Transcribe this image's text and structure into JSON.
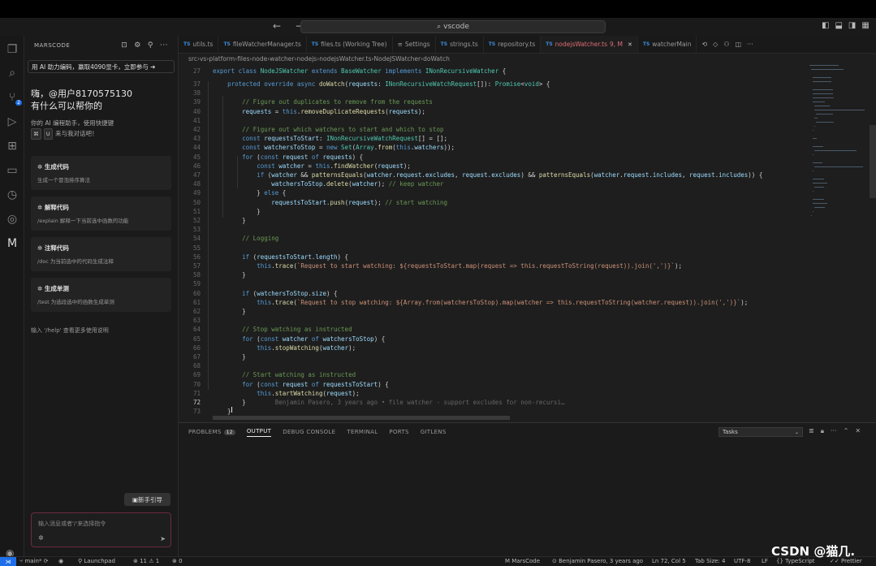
{
  "window": {
    "search": "vscode"
  },
  "sidebar": {
    "title": "MARSCODE",
    "banner": "用 AI 助力编码，赢取4090显卡，立即参与 ➔",
    "greeting_line1": "嗨，@用户8170575130",
    "greeting_line2": "有什么可以帮你的",
    "intro_line1": "你的 AI 编程助手，使用快捷键",
    "intro_keys": [
      "⌘",
      "U"
    ],
    "intro_line2": "来与我对话吧！",
    "cards": [
      {
        "title": "生成代码",
        "desc": "生成一个冒泡排序算法"
      },
      {
        "title": "解释代码",
        "desc": "/explain 解释一下当前选中函数的功能"
      },
      {
        "title": "注释代码",
        "desc": "/doc 为当前选中的代码生成注释"
      },
      {
        "title": "生成单测",
        "desc": "/test 为选段选中的函数生成单测"
      }
    ],
    "help": "输入 '/help' 查看更多使用说明",
    "guide_button": "新手引导",
    "chat_placeholder": "输入消息或者'/'来选择指令"
  },
  "tabs": [
    {
      "name": "utils.ts",
      "ts": true
    },
    {
      "name": "fileWatcherManager.ts",
      "ts": true
    },
    {
      "name": "files.ts (Working Tree)",
      "ts": true
    },
    {
      "name": "Settings",
      "ts": false
    },
    {
      "name": "strings.ts",
      "ts": true
    },
    {
      "name": "repository.ts",
      "ts": true
    },
    {
      "name": "nodejsWatcher.ts",
      "ts": true,
      "active": true,
      "status": "9, M"
    },
    {
      "name": "watcherMain",
      "ts": true
    }
  ],
  "breadcrumb": [
    "src",
    "vs",
    "platform",
    "files",
    "node",
    "watcher",
    "nodejs",
    "nodejsWatcher.ts",
    "NodeJSWatcher",
    "doWatch"
  ],
  "code": {
    "header_line": "27",
    "header_text": "export class NodeJSWatcher extends BaseWatcher implements INonRecursiveWatcher {",
    "lines": [
      {
        "n": "37",
        "t": "    protected override async doWatch(requests: INonRecursiveWatchRequest[]): Promise<void> {"
      },
      {
        "n": "38",
        "t": ""
      },
      {
        "n": "39",
        "t": "        // Figure out duplicates to remove from the requests"
      },
      {
        "n": "40",
        "t": "        requests = this.removeDuplicateRequests(requests);"
      },
      {
        "n": "41",
        "t": ""
      },
      {
        "n": "42",
        "t": "        // Figure out which watchers to start and which to stop"
      },
      {
        "n": "43",
        "t": "        const requestsToStart: INonRecursiveWatchRequest[] = [];"
      },
      {
        "n": "44",
        "t": "        const watchersToStop = new Set(Array.from(this.watchers));"
      },
      {
        "n": "45",
        "t": "        for (const request of requests) {"
      },
      {
        "n": "46",
        "t": "            const watcher = this.findWatcher(request);"
      },
      {
        "n": "47",
        "t": "            if (watcher && patternsEquals(watcher.request.excludes, request.excludes) && patternsEquals(watcher.request.includes, request.includes)) {"
      },
      {
        "n": "48",
        "t": "                watchersToStop.delete(watcher); // keep watcher"
      },
      {
        "n": "49",
        "t": "            } else {"
      },
      {
        "n": "50",
        "t": "                requestsToStart.push(request); // start watching"
      },
      {
        "n": "51",
        "t": "            }"
      },
      {
        "n": "52",
        "t": "        }"
      },
      {
        "n": "53",
        "t": ""
      },
      {
        "n": "54",
        "t": "        // Logging"
      },
      {
        "n": "55",
        "t": ""
      },
      {
        "n": "56",
        "t": "        if (requestsToStart.length) {"
      },
      {
        "n": "57",
        "t": "            this.trace(`Request to start watching: ${requestsToStart.map(request => this.requestToString(request)).join(',')}`);"
      },
      {
        "n": "58",
        "t": "        }"
      },
      {
        "n": "59",
        "t": ""
      },
      {
        "n": "60",
        "t": "        if (watchersToStop.size) {"
      },
      {
        "n": "61",
        "t": "            this.trace(`Request to stop watching: ${Array.from(watchersToStop).map(watcher => this.requestToString(watcher.request)).join(',')}`);"
      },
      {
        "n": "62",
        "t": "        }"
      },
      {
        "n": "63",
        "t": ""
      },
      {
        "n": "64",
        "t": "        // Stop watching as instructed"
      },
      {
        "n": "65",
        "t": "        for (const watcher of watchersToStop) {"
      },
      {
        "n": "66",
        "t": "            this.stopWatching(watcher);"
      },
      {
        "n": "67",
        "t": "        }"
      },
      {
        "n": "68",
        "t": ""
      },
      {
        "n": "69",
        "t": "        // Start watching as instructed"
      },
      {
        "n": "70",
        "t": "        for (const request of requestsToStart) {"
      },
      {
        "n": "71",
        "t": "            this.startWatching(request);"
      },
      {
        "n": "72",
        "t": "        }"
      },
      {
        "n": "73",
        "t": "    }"
      }
    ],
    "blame": "Benjamin Pasero, 3 years ago • file watcher - support excludes for non-recursi…"
  },
  "panel": {
    "tabs": [
      "PROBLEMS",
      "OUTPUT",
      "DEBUG CONSOLE",
      "TERMINAL",
      "PORTS",
      "GITLENS"
    ],
    "problems_count": "12",
    "active_tab": "OUTPUT",
    "tasks": "Tasks"
  },
  "status": {
    "branch": "main*",
    "launchpad": "Launchpad",
    "problems": "⊗ 11 ⚠ 1",
    "ports": "⊗ 0",
    "marscode": "MarsCode",
    "blame": "Benjamin Pasero, 3 years ago",
    "position": "Ln 72, Col 5",
    "tab_size": "Tab Size: 4",
    "encoding": "UTF-8",
    "eol": "LF",
    "language": "TypeScript",
    "prettier": "Prettier"
  },
  "watermark": "CSDN @猫几."
}
